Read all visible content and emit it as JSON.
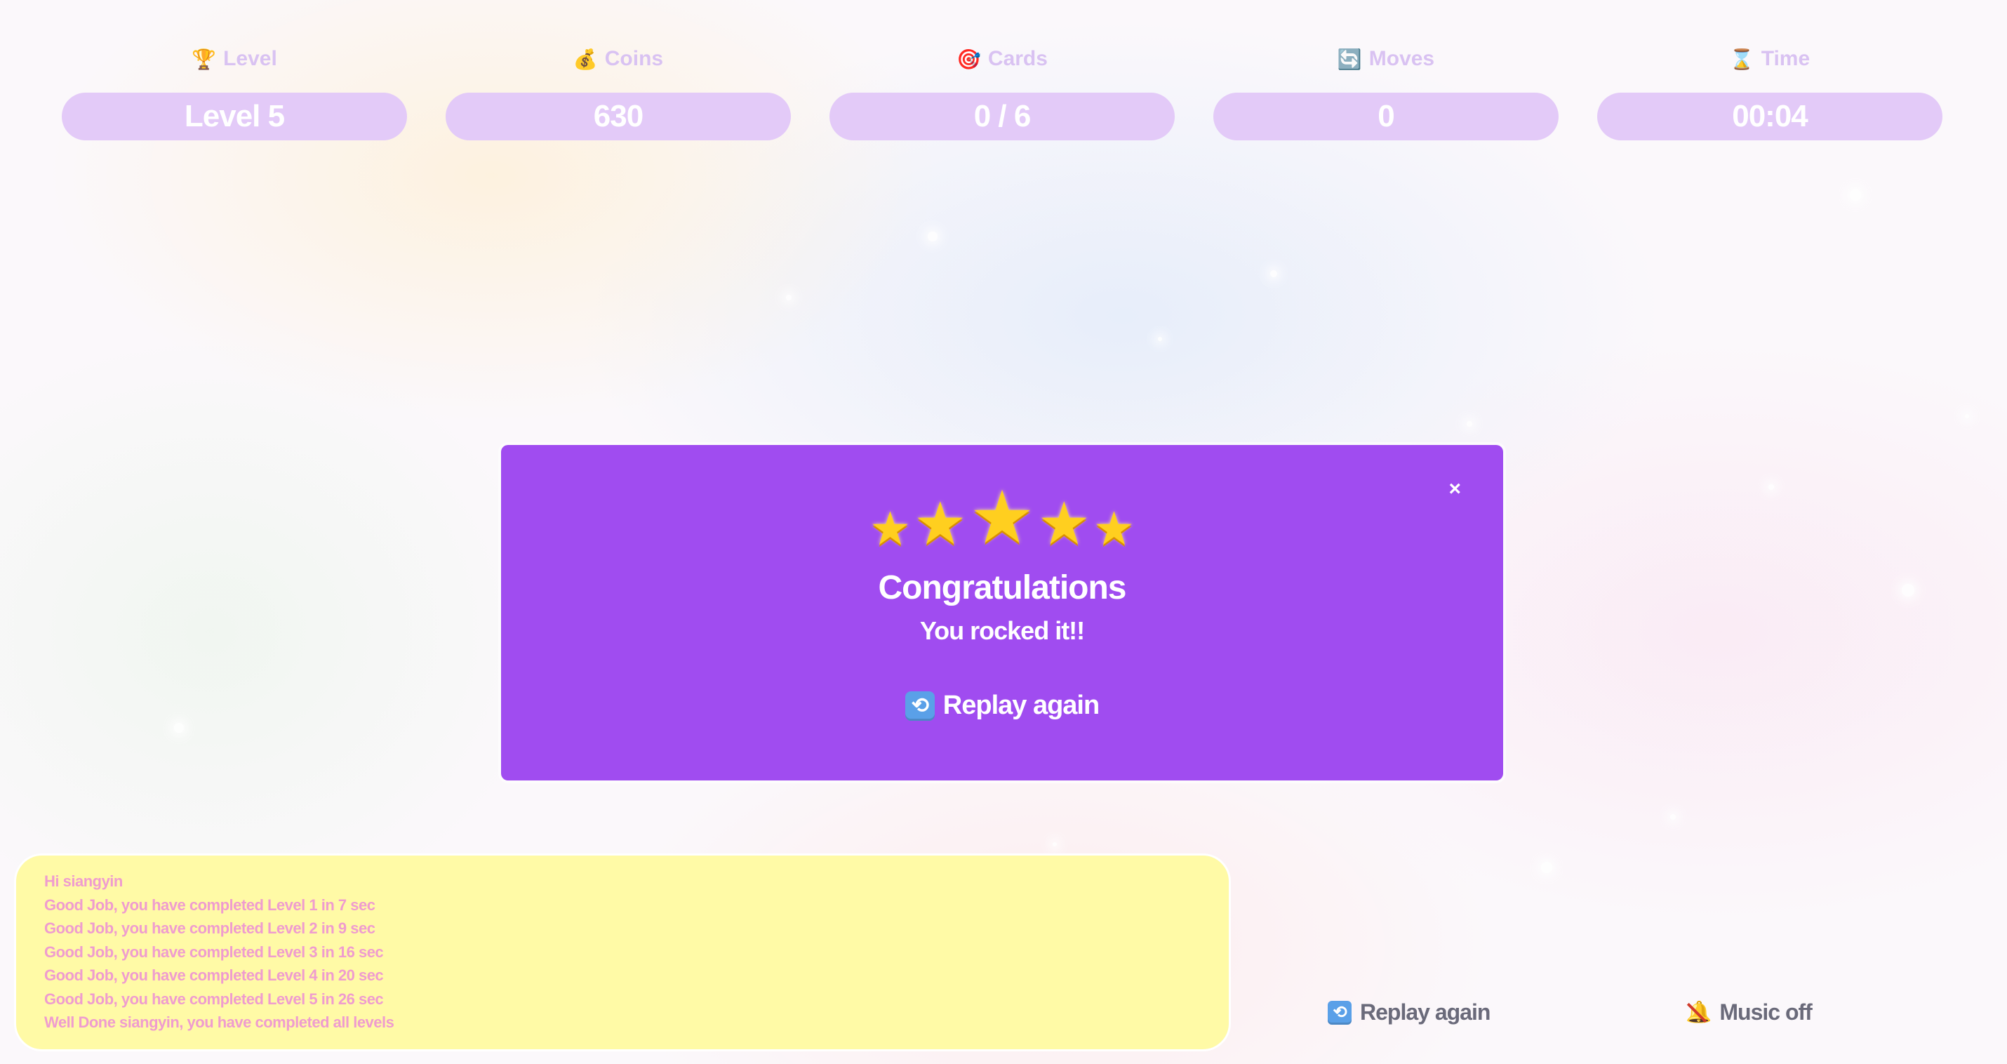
{
  "stats": [
    {
      "key": "level",
      "icon": "trophy-icon",
      "glyph": "🏆",
      "label": "Level",
      "value": "Level 5"
    },
    {
      "key": "coins",
      "icon": "money-bag-icon",
      "glyph": "💰",
      "label": "Coins",
      "value": "630"
    },
    {
      "key": "cards",
      "icon": "target-icon",
      "glyph": "🎯",
      "label": "Cards",
      "value": "0 / 6"
    },
    {
      "key": "moves",
      "icon": "cycle-icon",
      "glyph": "🔄",
      "label": "Moves",
      "value": "0"
    },
    {
      "key": "time",
      "icon": "hourglass-icon",
      "glyph": "⌛",
      "label": "Time",
      "value": "00:04"
    }
  ],
  "modal": {
    "star_count": 5,
    "title": "Congratulations",
    "subtitle": "You rocked it!!",
    "replay_label": "Replay again",
    "close_glyph": "×"
  },
  "log": {
    "lines": [
      "Hi siangyin",
      "Good Job, you have completed Level 1 in 7 sec",
      "Good Job, you have completed Level 2 in 9 sec",
      "Good Job, you have completed Level 3 in 16 sec",
      "Good Job, you have completed Level 4 in 20 sec",
      "Good Job, you have completed Level 5 in 26 sec",
      "Well Done siangyin, you have completed all levels"
    ]
  },
  "controls": {
    "replay_label": "Replay again",
    "music_label": "Music off"
  },
  "colors": {
    "modal_bg": "#a04cf0",
    "stat_pill": "#e3caf8",
    "stat_label": "#d9c2f2",
    "log_bg": "#fffaa6",
    "log_text": "#ef9ccf",
    "star": "#ffcf1f"
  }
}
